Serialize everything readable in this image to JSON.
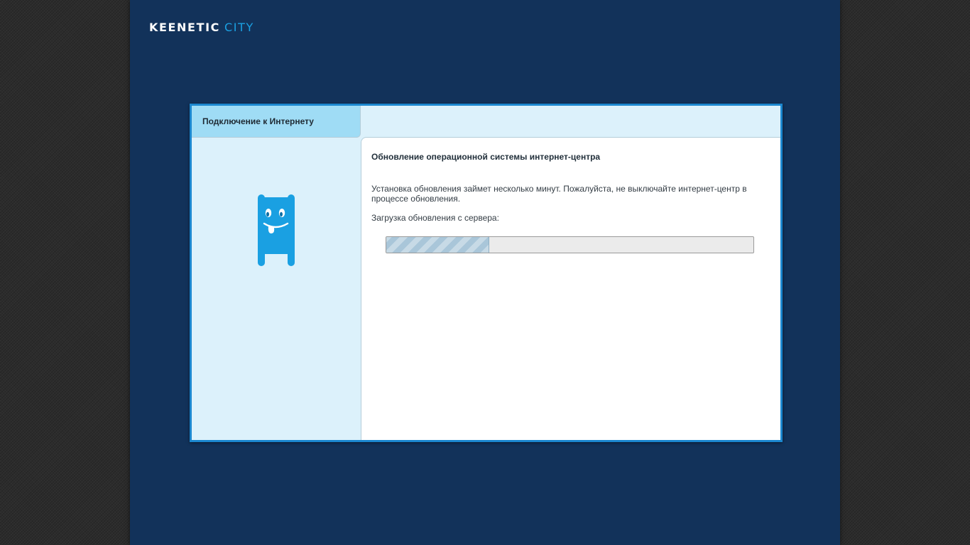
{
  "logo": {
    "brand": "KEENETIC",
    "model": "CITY"
  },
  "tab": {
    "label": "Подключение к Интернету"
  },
  "mascot": {
    "icon": "keenetic-mascot-icon",
    "color": "#1aa0e2"
  },
  "content": {
    "title": "Обновление операционной системы интернет-центра",
    "description": "Установка обновления займет несколько минут. Пожалуйста, не выключайте интернет-центр в процессе обновления.",
    "download_label": "Загрузка обновления с сервера:",
    "progress_fraction": 0.28
  },
  "colors": {
    "page_background": "#12325a",
    "panel_border": "#1b87cf",
    "panel_background": "#dcf1fb",
    "tab_background": "#9fdcf5",
    "logo_accent": "#1ba0e2"
  }
}
